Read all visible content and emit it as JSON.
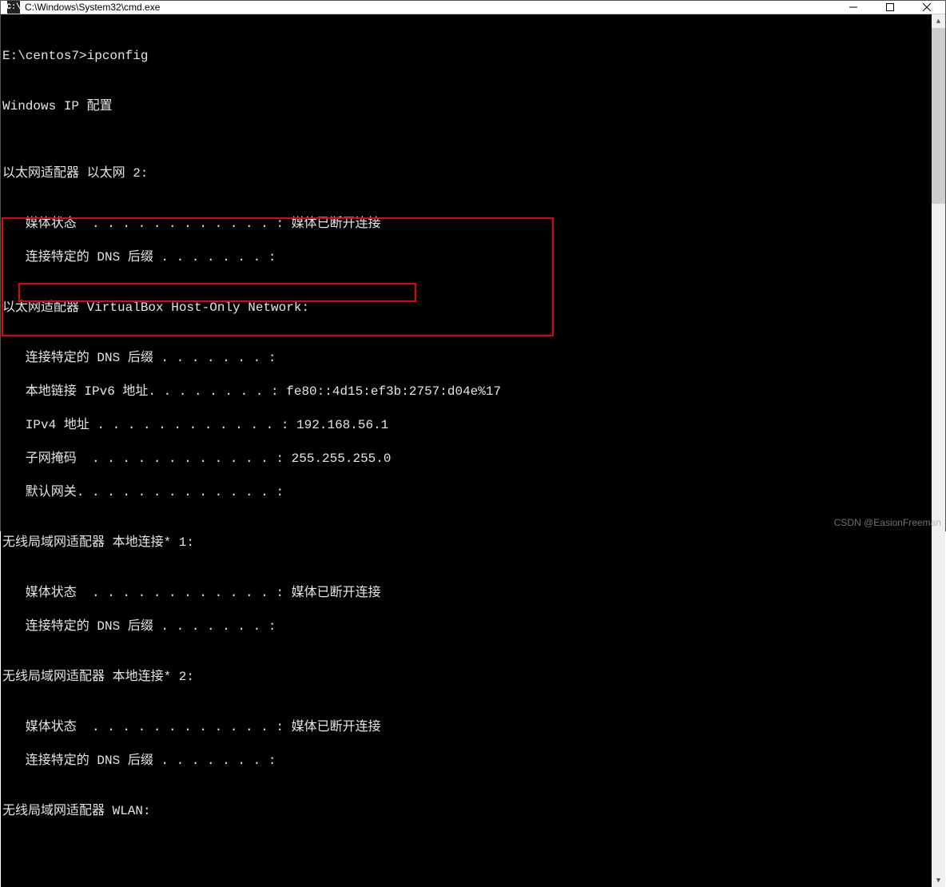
{
  "window": {
    "icon_text": "C:\\",
    "title": "C:\\Windows\\System32\\cmd.exe"
  },
  "terminal": {
    "blank": "",
    "prompt_line": "E:\\centos7>ipconfig",
    "header": "Windows IP 配置",
    "adapter1": {
      "title": "以太网适配器 以太网 2:",
      "media_state": "   媒体状态  . . . . . . . . . . . . : 媒体已断开连接",
      "dns_suffix": "   连接特定的 DNS 后缀 . . . . . . . :"
    },
    "adapter2": {
      "title": "以太网适配器 VirtualBox Host-Only Network:",
      "dns_suffix": "   连接特定的 DNS 后缀 . . . . . . . :",
      "ipv6": "   本地链接 IPv6 地址. . . . . . . . : fe80::4d15:ef3b:2757:d04e%17",
      "ipv4": "   IPv4 地址 . . . . . . . . . . . . : 192.168.56.1",
      "subnet": "   子网掩码  . . . . . . . . . . . . : 255.255.255.0",
      "gateway": "   默认网关. . . . . . . . . . . . . :"
    },
    "adapter3": {
      "title": "无线局域网适配器 本地连接* 1:",
      "media_state": "   媒体状态  . . . . . . . . . . . . : 媒体已断开连接",
      "dns_suffix": "   连接特定的 DNS 后缀 . . . . . . . :"
    },
    "adapter4": {
      "title": "无线局域网适配器 本地连接* 2:",
      "media_state": "   媒体状态  . . . . . . . . . . . . : 媒体已断开连接",
      "dns_suffix": "   连接特定的 DNS 后缀 . . . . . . . :"
    },
    "adapter5": {
      "title": "无线局域网适配器 WLAN:"
    }
  },
  "watermark": "CSDN @EasionFreeman"
}
